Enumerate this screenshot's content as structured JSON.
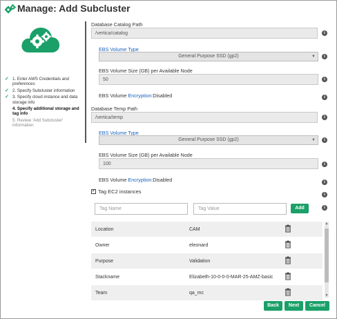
{
  "window": {
    "title": "Manage: Add Subcluster"
  },
  "steps": [
    {
      "label": "1. Enter AWS Credentials and preferences",
      "state": "done"
    },
    {
      "label": "2. Specify Subcluster information",
      "state": "done"
    },
    {
      "label": "3. Specify cloud instance and data storage info",
      "state": "done"
    },
    {
      "label": "4. Specify additional storage and tag info",
      "state": "current"
    },
    {
      "label": "5. Review 'Add Subcluster' information",
      "state": "pending"
    }
  ],
  "catalog": {
    "path_label": "Database Catalog Path",
    "path_value": "/vertica/catalog",
    "ebs_type_label": "EBS Volume Type",
    "ebs_type_value": "General Purpose SSD (gp2)",
    "ebs_size_label": "EBS Volume Size (GB) per Available Node",
    "ebs_size_value": "50",
    "enc_prefix": "EBS Volume ",
    "enc_link": "Encryption",
    "enc_value": ":Disabled"
  },
  "temp": {
    "path_label": "Database Temp Path",
    "path_value": "/vertica/temp",
    "ebs_type_label": "EBS Volume Type",
    "ebs_type_value": "General Purpose SSD (gp2)",
    "ebs_size_label": "EBS Volume Size (GB) per Available Node",
    "ebs_size_value": "100",
    "enc_prefix": "EBS Volume ",
    "enc_link": "Encryption",
    "enc_value": ":Disabled"
  },
  "tags": {
    "checkbox_label": "Tag EC2 instances",
    "checked": true,
    "name_placeholder": "Tag Name",
    "value_placeholder": "Tag Value",
    "add_label": "Add",
    "rows": [
      {
        "key": "Location",
        "value": "CAM"
      },
      {
        "key": "Owner",
        "value": "eleonard"
      },
      {
        "key": "Purpose",
        "value": "Validation"
      },
      {
        "key": "Stackname",
        "value": "Elizabeth-10-0-0-0-MAR-25-AMZ-basic"
      },
      {
        "key": "Team",
        "value": "qa_mc"
      }
    ]
  },
  "footer": {
    "back_label": "Back",
    "next_label": "Next",
    "cancel_label": "Cancel"
  },
  "colors": {
    "accent": "#1aa068",
    "link": "#1560bd"
  },
  "icons": {
    "title": "gears-icon",
    "logo": "cloud-gears-icon",
    "info": "info-icon",
    "delete": "trash-icon",
    "check": "check-icon"
  }
}
